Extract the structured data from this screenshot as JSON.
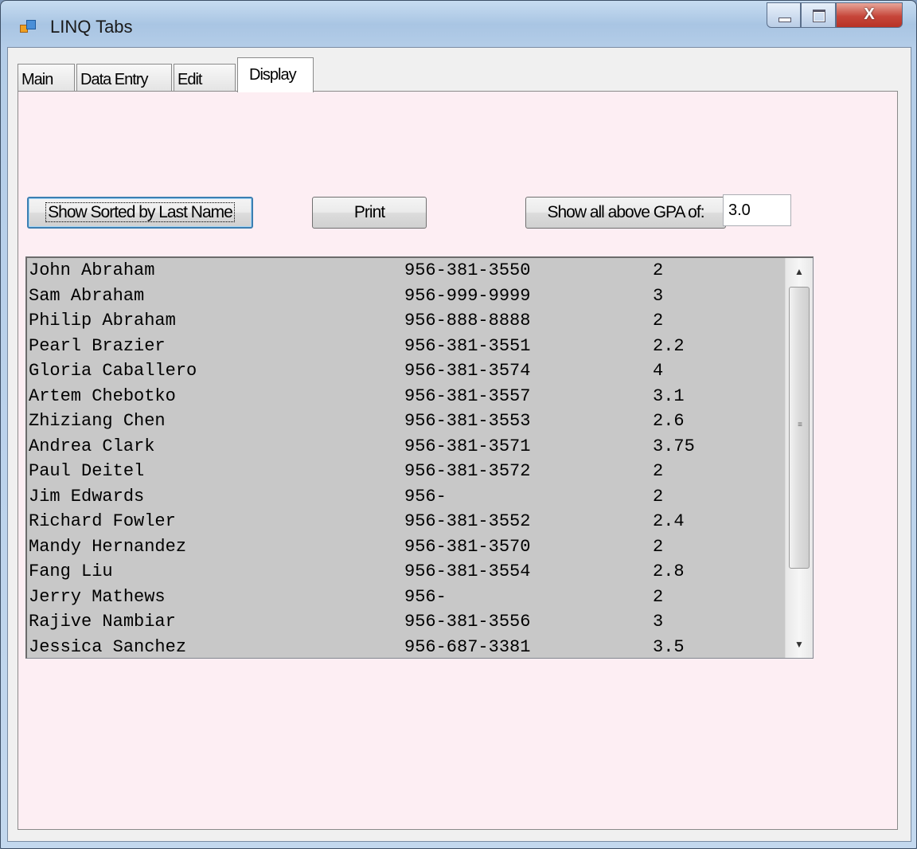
{
  "window": {
    "title": "LINQ Tabs",
    "controls": {
      "minimize": "minimize",
      "maximize": "maximize",
      "close": "X"
    }
  },
  "tabs": [
    {
      "label": "Main",
      "active": false
    },
    {
      "label": "Data Entry",
      "active": false
    },
    {
      "label": "Edit",
      "active": false
    },
    {
      "label": "Display",
      "active": true
    }
  ],
  "display": {
    "sort_button": "Show Sorted by Last Name",
    "print_button": "Print",
    "gpa_button": "Show all above GPA of:",
    "gpa_value": "3.0",
    "students": [
      {
        "name": "John Abraham",
        "phone": "956-381-3550",
        "gpa": "2"
      },
      {
        "name": "Sam Abraham",
        "phone": "956-999-9999",
        "gpa": "3"
      },
      {
        "name": "Philip Abraham",
        "phone": "956-888-8888",
        "gpa": "2"
      },
      {
        "name": "Pearl Brazier",
        "phone": "956-381-3551",
        "gpa": "2.2"
      },
      {
        "name": "Gloria Caballero",
        "phone": "956-381-3574",
        "gpa": "4"
      },
      {
        "name": "Artem Chebotko",
        "phone": "956-381-3557",
        "gpa": "3.1"
      },
      {
        "name": "Zhiziang Chen",
        "phone": "956-381-3553",
        "gpa": "2.6"
      },
      {
        "name": "Andrea Clark",
        "phone": "956-381-3571",
        "gpa": "3.75"
      },
      {
        "name": "Paul Deitel",
        "phone": "956-381-3572",
        "gpa": "2"
      },
      {
        "name": "Jim Edwards",
        "phone": "956-",
        "gpa": "2"
      },
      {
        "name": "Richard Fowler",
        "phone": "956-381-3552",
        "gpa": "2.4"
      },
      {
        "name": "Mandy Hernandez",
        "phone": "956-381-3570",
        "gpa": "2"
      },
      {
        "name": "Fang Liu",
        "phone": "956-381-3554",
        "gpa": "2.8"
      },
      {
        "name": "Jerry Mathews",
        "phone": "956-",
        "gpa": "2"
      },
      {
        "name": "Rajive Nambiar",
        "phone": "956-381-3556",
        "gpa": "3"
      },
      {
        "name": "Jessica Sanchez",
        "phone": "956-687-3381",
        "gpa": "3.5"
      }
    ]
  },
  "colors": {
    "tab_page_background": "#fdeef3",
    "listbox_background": "#c8c8c8",
    "close_button": "#c6463a"
  }
}
